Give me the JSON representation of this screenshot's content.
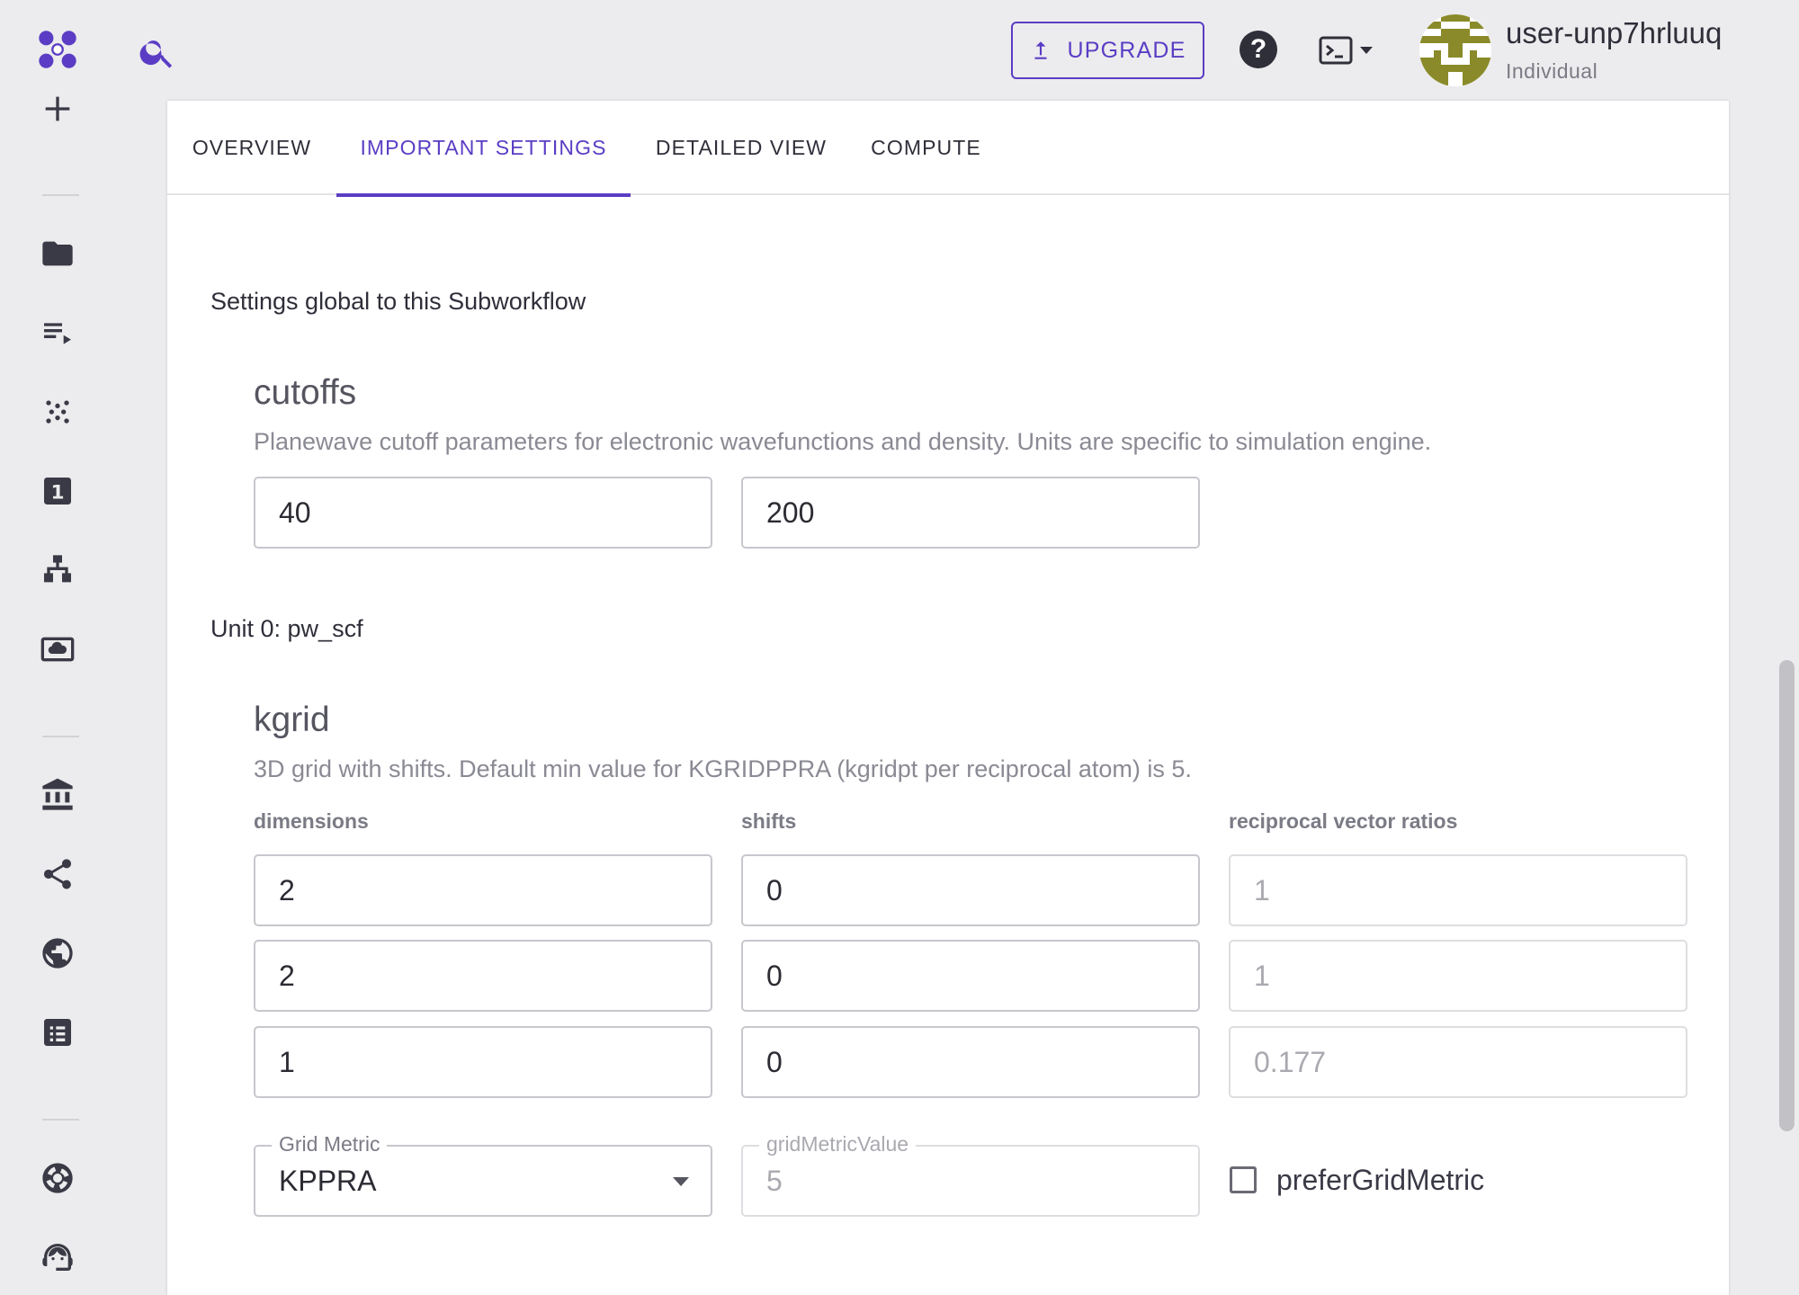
{
  "app": {
    "logo_icon": "molecule-logo-icon",
    "accent_color": "#5a3dc4"
  },
  "sidebar": {
    "items": [
      {
        "icon": "plus-icon"
      },
      {
        "icon": "folder-icon"
      },
      {
        "icon": "playlist-play-icon"
      },
      {
        "icon": "dots-grid-icon"
      },
      {
        "icon": "numbered-box-icon",
        "label": "1"
      },
      {
        "icon": "hierarchy-icon"
      },
      {
        "icon": "cloud-screen-icon"
      },
      {
        "icon": "bank-icon"
      },
      {
        "icon": "share-icon"
      },
      {
        "icon": "globe-icon"
      },
      {
        "icon": "checklist-icon"
      },
      {
        "icon": "lifebuoy-icon"
      },
      {
        "icon": "support-agent-icon"
      }
    ]
  },
  "header": {
    "upgrade_label": "UPGRADE",
    "help_label": "?",
    "user_name": "user-unp7hrluuq",
    "user_role": "Individual"
  },
  "tabs": [
    {
      "label": "OVERVIEW",
      "active": false
    },
    {
      "label": "IMPORTANT SETTINGS",
      "active": true
    },
    {
      "label": "DETAILED VIEW",
      "active": false
    },
    {
      "label": "COMPUTE",
      "active": false
    }
  ],
  "global_section": {
    "title": "Settings global to this Subworkflow",
    "cutoffs": {
      "title": "cutoffs",
      "description": "Planewave cutoff parameters for electronic wavefunctions and density. Units are specific to simulation engine.",
      "values": [
        "40",
        "200"
      ]
    }
  },
  "unit_section": {
    "title": "Unit 0: pw_scf",
    "kgrid": {
      "title": "kgrid",
      "description": "3D grid with shifts. Default min value for KGRIDPPRA (kgridpt per reciprocal atom) is 5.",
      "columns": {
        "dimensions": "dimensions",
        "shifts": "shifts",
        "ratios": "reciprocal vector ratios"
      },
      "dimensions": [
        "2",
        "2",
        "1"
      ],
      "shifts": [
        "0",
        "0",
        "0"
      ],
      "ratios": [
        "1",
        "1",
        "0.177"
      ],
      "grid_metric": {
        "label": "Grid Metric",
        "value": "KPPRA"
      },
      "grid_metric_value": {
        "label": "gridMetricValue",
        "value": "5"
      },
      "prefer_grid_metric": {
        "label": "preferGridMetric",
        "checked": false
      }
    }
  }
}
